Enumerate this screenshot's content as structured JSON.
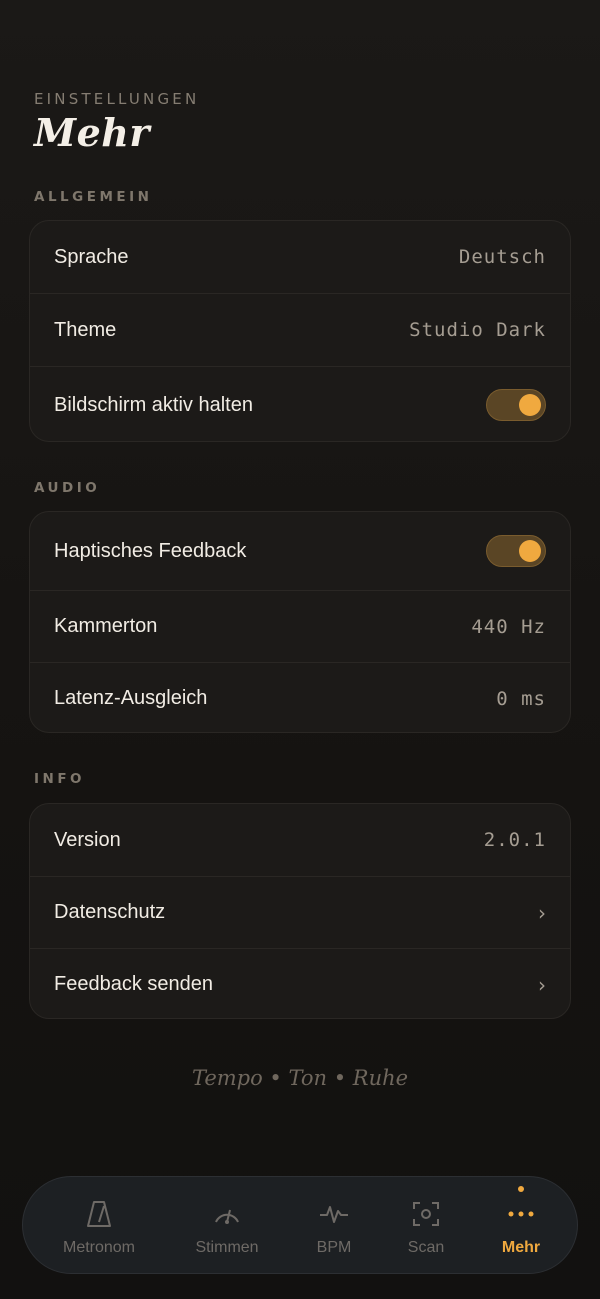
{
  "header": {
    "eyebrow": "EINSTELLUNGEN",
    "title": "Mehr"
  },
  "sections": {
    "general": {
      "label": "ALLGEMEIN",
      "language": {
        "label": "Sprache",
        "value": "Deutsch"
      },
      "theme": {
        "label": "Theme",
        "value": "Studio Dark"
      },
      "keep_awake": {
        "label": "Bildschirm aktiv halten",
        "on": true
      }
    },
    "audio": {
      "label": "AUDIO",
      "haptic": {
        "label": "Haptisches Feedback",
        "on": true
      },
      "pitch": {
        "label": "Kammerton",
        "value": "440 Hz"
      },
      "latency": {
        "label": "Latenz-Ausgleich",
        "value": "0 ms"
      }
    },
    "info": {
      "label": "INFO",
      "version": {
        "label": "Version",
        "value": "2.0.1"
      },
      "privacy": {
        "label": "Datenschutz",
        "chevron": "›"
      },
      "feedback": {
        "label": "Feedback senden",
        "chevron": "›"
      }
    }
  },
  "tagline": "Tempo • Ton • Ruhe",
  "tabbar": {
    "tabs": [
      {
        "label": "Metronom",
        "icon": "metronome-icon"
      },
      {
        "label": "Stimmen",
        "icon": "tuner-icon"
      },
      {
        "label": "BPM",
        "icon": "pulse-icon"
      },
      {
        "label": "Scan",
        "icon": "scan-icon"
      },
      {
        "label": "Mehr",
        "icon": "more-icon",
        "active": true
      }
    ]
  },
  "colors": {
    "accent": "#f0a93f",
    "background": "#151311",
    "card": "#1c1a18"
  }
}
